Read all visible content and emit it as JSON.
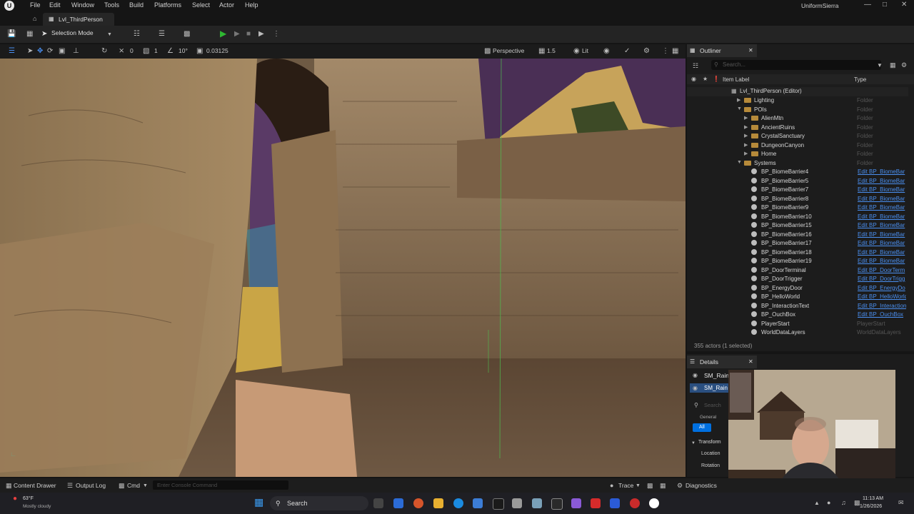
{
  "menubar": {
    "items": [
      "File",
      "Edit",
      "Window",
      "Tools",
      "Build",
      "Platforms",
      "Select",
      "Actor",
      "Help"
    ],
    "user": "UniformSierra",
    "logo": "U"
  },
  "tab": {
    "label": "Lvl_ThirdPerson"
  },
  "toolbar": {
    "selection_mode": "Selection Mode"
  },
  "viewport_toolbar": {
    "grid_a": "0",
    "grid_b": "1",
    "angle": "10°",
    "scale": "0.03125",
    "view": "Perspective",
    "speed": "1.5",
    "lit": "Lit"
  },
  "outliner": {
    "title": "Outliner",
    "search_placeholder": "Search...",
    "col_label": "Item Label",
    "col_type": "Type",
    "root": "Lvl_ThirdPerson (Editor)",
    "rows": [
      {
        "label": "Lighting",
        "type": "Folder",
        "kind": "folder",
        "indent": 1
      },
      {
        "label": "POIs",
        "type": "Folder",
        "kind": "folder",
        "indent": 1
      },
      {
        "label": "AlienMtn",
        "type": "Folder",
        "kind": "folder",
        "indent": 2
      },
      {
        "label": "AncientRuins",
        "type": "Folder",
        "kind": "folder",
        "indent": 2
      },
      {
        "label": "CrystalSanctuary",
        "type": "Folder",
        "kind": "folder",
        "indent": 2
      },
      {
        "label": "DungeonCanyon",
        "type": "Folder",
        "kind": "folder",
        "indent": 2
      },
      {
        "label": "Home",
        "type": "Folder",
        "kind": "folder",
        "indent": 2
      },
      {
        "label": "Systems",
        "type": "Folder",
        "kind": "folder",
        "indent": 1
      },
      {
        "label": "BP_BiomeBarrier4",
        "type": "Edit BP_BiomeBar",
        "kind": "actor",
        "indent": 2
      },
      {
        "label": "BP_BiomeBarrier5",
        "type": "Edit BP_BiomeBar",
        "kind": "actor",
        "indent": 2
      },
      {
        "label": "BP_BiomeBarrier7",
        "type": "Edit BP_BiomeBar",
        "kind": "actor",
        "indent": 2
      },
      {
        "label": "BP_BiomeBarrier8",
        "type": "Edit BP_BiomeBar",
        "kind": "actor",
        "indent": 2
      },
      {
        "label": "BP_BiomeBarrier9",
        "type": "Edit BP_BiomeBar",
        "kind": "actor",
        "indent": 2
      },
      {
        "label": "BP_BiomeBarrier10",
        "type": "Edit BP_BiomeBar",
        "kind": "actor",
        "indent": 2
      },
      {
        "label": "BP_BiomeBarrier15",
        "type": "Edit BP_BiomeBar",
        "kind": "actor",
        "indent": 2
      },
      {
        "label": "BP_BiomeBarrier16",
        "type": "Edit BP_BiomeBar",
        "kind": "actor",
        "indent": 2
      },
      {
        "label": "BP_BiomeBarrier17",
        "type": "Edit BP_BiomeBar",
        "kind": "actor",
        "indent": 2
      },
      {
        "label": "BP_BiomeBarrier18",
        "type": "Edit BP_BiomeBar",
        "kind": "actor",
        "indent": 2
      },
      {
        "label": "BP_BiomeBarrier19",
        "type": "Edit BP_BiomeBar",
        "kind": "actor",
        "indent": 2
      },
      {
        "label": "BP_DoorTerminal",
        "type": "Edit BP_DoorTerm",
        "kind": "actor",
        "indent": 2
      },
      {
        "label": "BP_DoorTrigger",
        "type": "Edit BP_DoorTrigg",
        "kind": "actor",
        "indent": 2
      },
      {
        "label": "BP_EnergyDoor",
        "type": "Edit BP_EnergyDo",
        "kind": "actor",
        "indent": 2
      },
      {
        "label": "BP_HelloWorld",
        "type": "Edit BP_HelloWorld",
        "kind": "actor",
        "indent": 2
      },
      {
        "label": "BP_InteractionText",
        "type": "Edit BP_Interaction",
        "kind": "actor",
        "indent": 2
      },
      {
        "label": "BP_OuchBox",
        "type": "Edit BP_OuchBox",
        "kind": "actor",
        "indent": 2
      },
      {
        "label": "PlayerStart",
        "type": "PlayerStart",
        "kind": "actor",
        "indent": 2
      },
      {
        "label": "WorldDataLayers",
        "type": "WorldDataLayers",
        "kind": "actor",
        "indent": 2
      }
    ],
    "footer": "355 actors (1 selected)"
  },
  "details": {
    "title": "Details",
    "item1": "SM_Rain",
    "item2": "SM_Rain",
    "search_placeholder": "Search",
    "cat_general": "General",
    "cat_all": "All",
    "section": "Transform",
    "prop_location": "Location",
    "prop_rotation": "Rotation"
  },
  "bottombar": {
    "content_drawer": "Content Drawer",
    "output_log": "Output Log",
    "cmd": "Cmd",
    "cmd_placeholder": "Enter Console Command",
    "trace": "Trace",
    "diagnostics": "Diagnostics"
  },
  "taskbar": {
    "weather_temp": "63°F",
    "weather_desc": "Mostly cloudy",
    "search": "Search",
    "time": "11:13 AM",
    "date": "1/26/2026"
  },
  "colors": {
    "accent": "#0070e0",
    "link": "#4a8ff0",
    "play": "#2fb832"
  }
}
